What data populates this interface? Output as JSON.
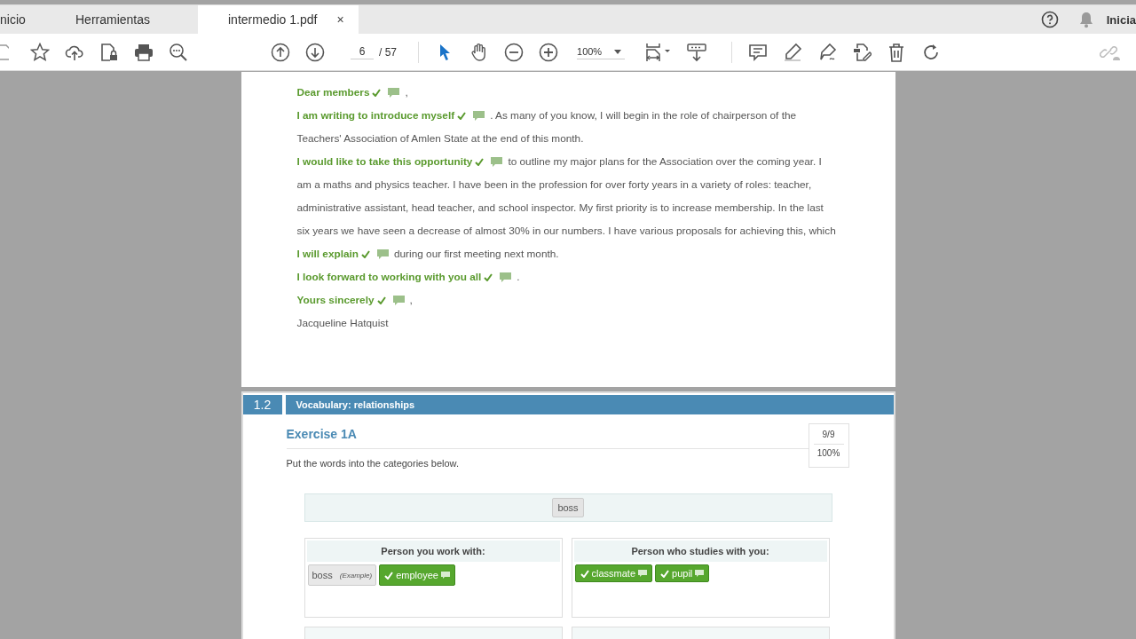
{
  "tabs": [
    {
      "label": "nicio",
      "selected": false,
      "closable": false
    },
    {
      "label": "Herramientas",
      "selected": false,
      "closable": false
    },
    {
      "label": "intermedio 1.pdf",
      "selected": true,
      "closable": true
    }
  ],
  "close_glyph": "×",
  "account_label": "Inicia",
  "toolbar": {
    "page_field": {
      "value": "6"
    },
    "page_count": "/ 57",
    "zoom": "100%",
    "select_tool": {
      "selected": true
    },
    "hand_tool": {
      "selected": false
    }
  },
  "letter": [
    {
      "answer": "Dear members",
      "correct": true,
      "text": ","
    },
    {
      "answer": "I am writing to introduce myself",
      "correct": true,
      "text": ". As many of you know, I will begin in the role of chairperson of the"
    },
    {
      "text": "Teachers' Association of Amlen State at the end of this month."
    },
    {
      "answer": "I would like to take this opportunity",
      "correct": true,
      "text": "to outline my major plans for the Association over the coming year. I"
    },
    {
      "text": "am a maths and physics teacher. I have been in the profession for over forty years in a variety of roles: teacher,"
    },
    {
      "text": "administrative assistant, head teacher, and school inspector. My first priority is to increase membership. In the last"
    },
    {
      "text": "six years we have seen a decrease of almost 30% in our numbers. I have various proposals for achieving this, which"
    },
    {
      "answer": "I will explain",
      "correct": true,
      "text": "during our first meeting next month."
    },
    {
      "answer": "I look forward to working with you all",
      "correct": true,
      "text": "."
    },
    {
      "answer": "Yours sincerely",
      "correct": true,
      "text": ","
    },
    {
      "text": "Jacqueline Hatquist"
    }
  ],
  "section": {
    "number": "1.2",
    "title": "Vocabulary: relationships"
  },
  "exercise": {
    "title": "Exercise 1A",
    "score": "9/9",
    "percent": "100%",
    "instruction": "Put the words into the categories below.",
    "word_bank": [
      "boss"
    ],
    "categories": [
      {
        "title": "Person you work with:",
        "chips": [
          {
            "kind": "example",
            "label": "boss",
            "note": "(Example)"
          },
          {
            "kind": "answer",
            "label": "employee",
            "correct": true
          }
        ]
      },
      {
        "title": "Person who studies with you:",
        "chips": [
          {
            "kind": "answer",
            "label": "classmate",
            "correct": true
          },
          {
            "kind": "answer",
            "label": "pupil",
            "correct": true
          }
        ]
      }
    ]
  }
}
